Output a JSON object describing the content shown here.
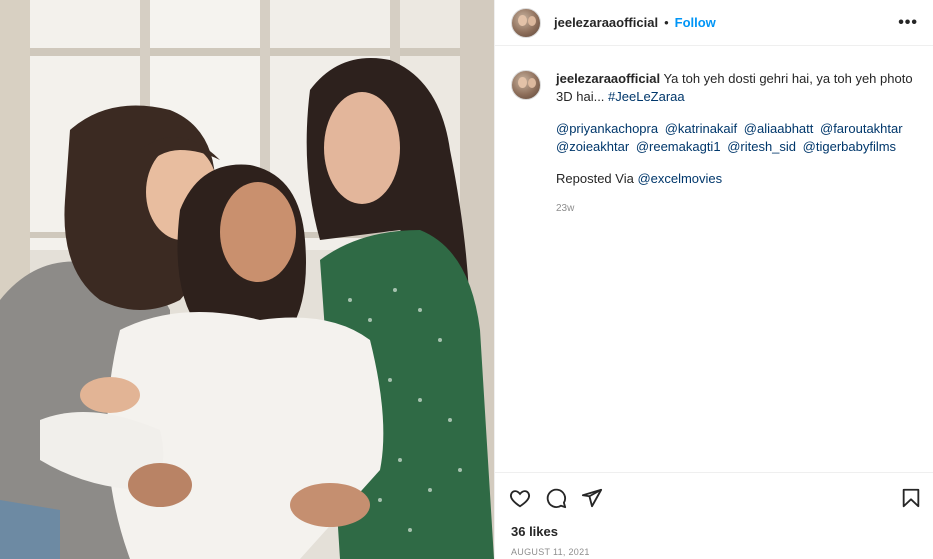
{
  "post": {
    "username": "jeelezaraaofficial",
    "dot": "•",
    "follow_label": "Follow",
    "more_icon": "more-horizontal-icon",
    "caption_text": "Ya toh yeh dosti gehri hai, ya toh yeh photo 3D hai... ",
    "caption_hashtag": "#JeeLeZaraa",
    "mentions": [
      "@priyankachopra",
      "@katrinakaif",
      "@aliaabhatt",
      "@faroutakhtar",
      "@zoieakhtar",
      "@reemakagti1",
      "@ritesh_sid",
      "@tigerbabyfilms"
    ],
    "repost_prefix": "Reposted Via ",
    "repost_handle": "@excelmovies",
    "time_ago": "23w",
    "likes": "36 likes",
    "date": "AUGUST 11, 2021"
  },
  "icons": {
    "like": "heart-icon",
    "comment": "comment-icon",
    "share": "share-icon",
    "save": "bookmark-icon"
  },
  "colors": {
    "follow": "#0095f6",
    "link": "#00376b",
    "secondary_text": "#8e8e8e",
    "divider": "#efefef"
  }
}
